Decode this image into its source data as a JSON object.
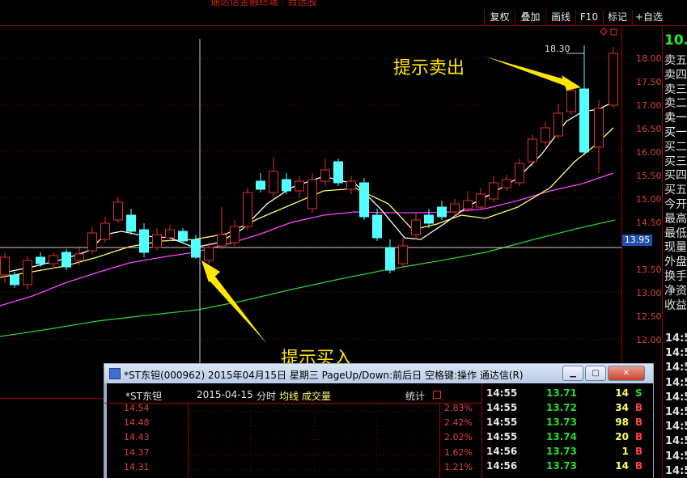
{
  "header": {
    "title": "通达信金融终端 · 自选股",
    "buttons": [
      "复权",
      "叠加",
      "画线",
      "F10",
      "标记",
      "+自选"
    ]
  },
  "chart": {
    "price_axis": [
      "18.00",
      "17.50",
      "17.00",
      "16.50",
      "16.00",
      "15.50",
      "15.00",
      "14.50",
      "13.50",
      "13.00",
      "12.50",
      "12.00"
    ],
    "cursor_price": "13.95",
    "high_marker": "18.30",
    "annotation_sell": "提示卖出",
    "annotation_buy": "提示买入"
  },
  "right_panel": {
    "price_head": "10.",
    "labels": [
      "卖五",
      "卖四",
      "卖三",
      "卖二",
      "卖一",
      "买一",
      "买二",
      "买三",
      "买四",
      "买五",
      "今开",
      "最高",
      "最低",
      "现量",
      "外盘",
      "换手",
      "净资",
      "收益"
    ],
    "times": [
      "14:5",
      "14:5",
      "14:5",
      "14:5",
      "14:5",
      "14:5",
      "14:5",
      "14:5",
      "14:5",
      "14:5"
    ]
  },
  "window": {
    "title": "*ST东钽(000962) 2015年04月15日 星期三 PageUp/Down:前后日 空格键:操作 通达信(R)",
    "chart_header": {
      "name": "*ST东钽",
      "date": "2015-04-15",
      "mode": "分时",
      "avg_label": "均线",
      "vol_label": "成交量",
      "stats_label": "统计"
    },
    "prices": [
      "14.54",
      "14.48",
      "14.43",
      "14.37",
      "14.31"
    ],
    "pcts": [
      "2.83%",
      "2.42%",
      "2.02%",
      "1.62%",
      "1.21%"
    ],
    "ticks": [
      {
        "time": "14:55",
        "price": "13.71",
        "vol": "14",
        "side": "S"
      },
      {
        "time": "14:55",
        "price": "13.72",
        "vol": "34",
        "side": "B"
      },
      {
        "time": "14:55",
        "price": "13.73",
        "vol": "98",
        "side": "B"
      },
      {
        "time": "14:55",
        "price": "13.74",
        "vol": "20",
        "side": "B"
      },
      {
        "time": "14:56",
        "price": "13.73",
        "vol": "1",
        "side": "B"
      },
      {
        "time": "14:56",
        "price": "13.73",
        "vol": "14",
        "side": "B"
      }
    ]
  },
  "colors": {
    "up": "#e03030",
    "down": "#54ffff",
    "ma_short": "#ffffff",
    "ma_mid": "#ffff66",
    "ma_long": "#ff44ff",
    "ma_xlong": "#33cc33",
    "buy": "#ff4040",
    "sell": "#22dd22"
  }
}
